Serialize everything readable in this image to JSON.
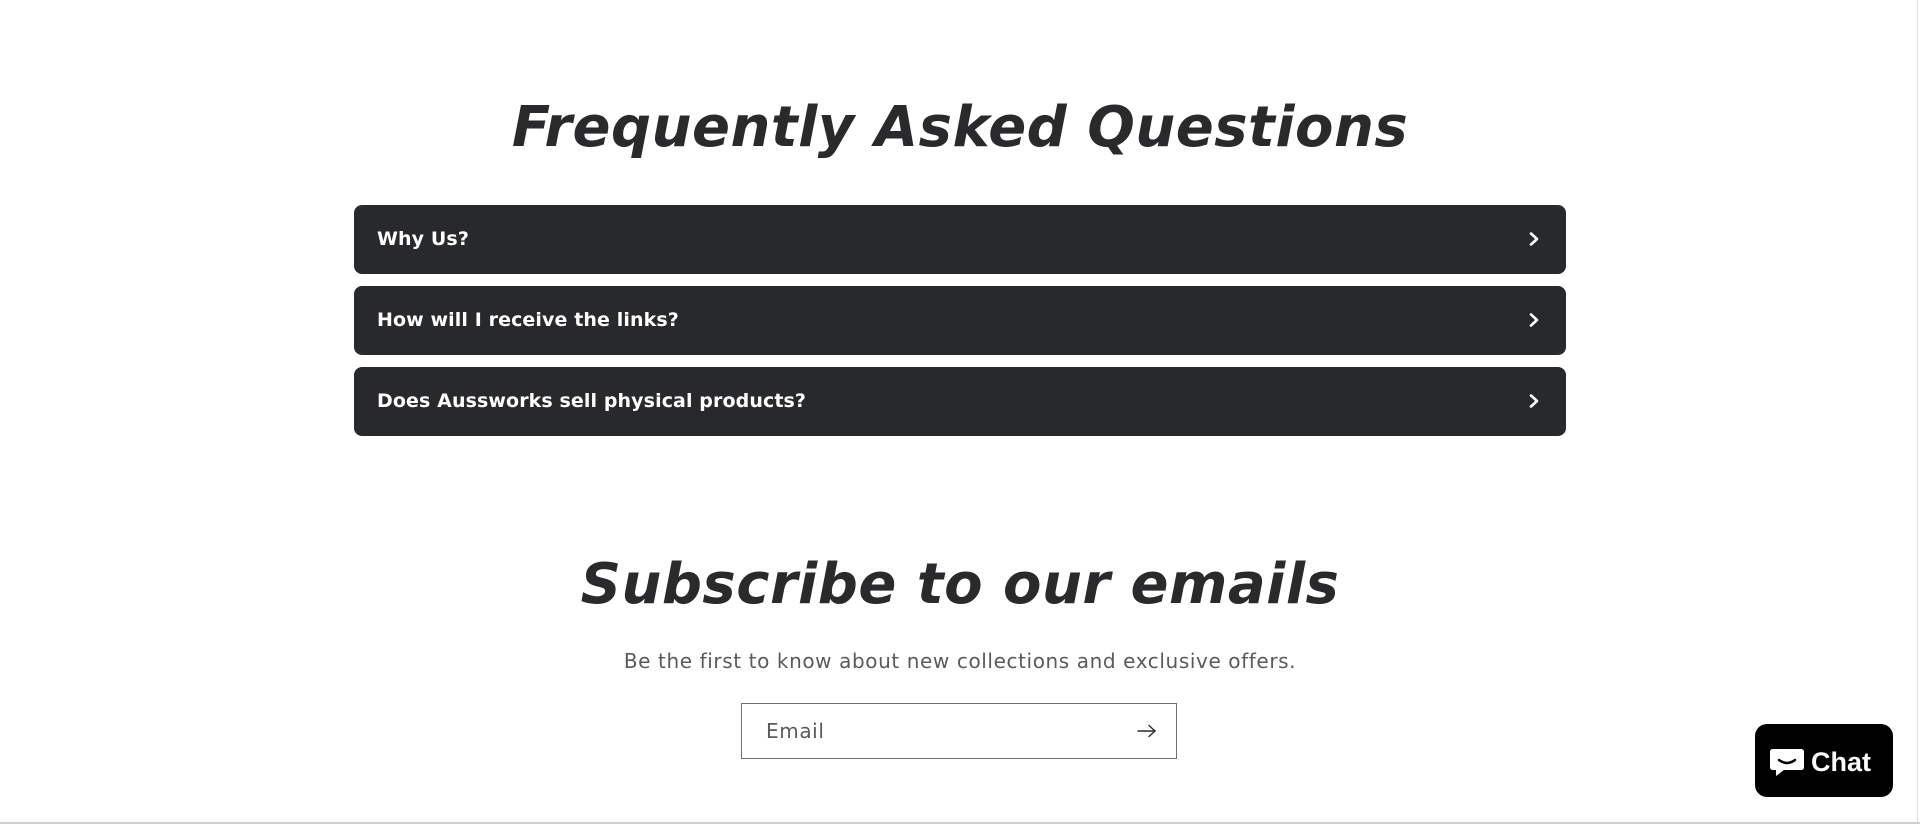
{
  "faq": {
    "title": "Frequently Asked Questions",
    "items": [
      {
        "label": "Why Us?",
        "icon": "chevron-right-icon"
      },
      {
        "label": "How will I receive the links?",
        "icon": "chevron-right-icon"
      },
      {
        "label": "Does Aussworks sell physical products?",
        "icon": "chevron-right-icon"
      }
    ]
  },
  "newsletter": {
    "title": "Subscribe to our emails",
    "description": "Be the first to know about new collections and exclusive offers.",
    "email_placeholder": "Email",
    "submit_icon": "arrow-right-icon"
  },
  "chat": {
    "label": "Chat",
    "icon": "chat-bubble-icon"
  },
  "colors": {
    "background": "#ffffff",
    "accordion_background": "#28292b",
    "heading_text": "#2a2a2c",
    "muted_text": "#5a5a5c",
    "chat_background": "#000000"
  }
}
